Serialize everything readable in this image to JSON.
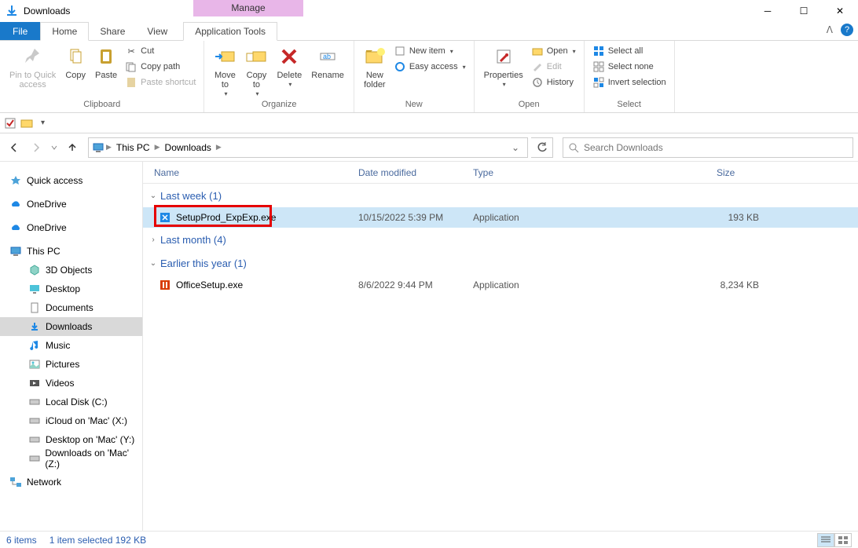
{
  "window": {
    "title": "Downloads",
    "context_tab": "Manage",
    "context_subtab": "Application Tools"
  },
  "tabs": {
    "file": "File",
    "home": "Home",
    "share": "Share",
    "view": "View"
  },
  "ribbon": {
    "clipboard": {
      "label": "Clipboard",
      "pin": "Pin to Quick\naccess",
      "copy": "Copy",
      "paste": "Paste",
      "cut": "Cut",
      "copypath": "Copy path",
      "pasteshort": "Paste shortcut"
    },
    "organize": {
      "label": "Organize",
      "moveto": "Move\nto",
      "copyto": "Copy\nto",
      "delete": "Delete",
      "rename": "Rename"
    },
    "new": {
      "label": "New",
      "newfolder": "New\nfolder",
      "newitem": "New item",
      "easyaccess": "Easy access"
    },
    "open": {
      "label": "Open",
      "properties": "Properties",
      "open": "Open",
      "edit": "Edit",
      "history": "History"
    },
    "select": {
      "label": "Select",
      "selectall": "Select all",
      "selectnone": "Select none",
      "invert": "Invert selection"
    }
  },
  "breadcrumb": {
    "root": "This PC",
    "current": "Downloads"
  },
  "search": {
    "placeholder": "Search Downloads"
  },
  "nav": {
    "quickaccess": "Quick access",
    "onedrive1": "OneDrive",
    "onedrive2": "OneDrive",
    "thispc": "This PC",
    "children": [
      {
        "key": "3dobjects",
        "label": "3D Objects"
      },
      {
        "key": "desktop",
        "label": "Desktop"
      },
      {
        "key": "documents",
        "label": "Documents"
      },
      {
        "key": "downloads",
        "label": "Downloads"
      },
      {
        "key": "music",
        "label": "Music"
      },
      {
        "key": "pictures",
        "label": "Pictures"
      },
      {
        "key": "videos",
        "label": "Videos"
      },
      {
        "key": "localdisk",
        "label": "Local Disk (C:)"
      },
      {
        "key": "icloud",
        "label": "iCloud on 'Mac' (X:)"
      },
      {
        "key": "desktopmac",
        "label": "Desktop on 'Mac' (Y:)"
      },
      {
        "key": "downloadsmac",
        "label": "Downloads on 'Mac' (Z:)"
      }
    ],
    "network": "Network"
  },
  "columns": {
    "name": "Name",
    "date": "Date modified",
    "type": "Type",
    "size": "Size"
  },
  "groups": [
    {
      "label": "Last week (1)",
      "expanded": true,
      "rows": [
        {
          "name": "SetupProd_ExpExp.exe",
          "date": "10/15/2022 5:39 PM",
          "type": "Application",
          "size": "193 KB",
          "selected": true,
          "highlighted": true,
          "icon": "exe-blue"
        }
      ]
    },
    {
      "label": "Last month (4)",
      "expanded": false,
      "rows": []
    },
    {
      "label": "Earlier this year (1)",
      "expanded": true,
      "rows": [
        {
          "name": "OfficeSetup.exe",
          "date": "8/6/2022 9:44 PM",
          "type": "Application",
          "size": "8,234 KB",
          "selected": false,
          "icon": "office"
        }
      ]
    }
  ],
  "status": {
    "items": "6 items",
    "selected": "1 item selected  192 KB"
  }
}
